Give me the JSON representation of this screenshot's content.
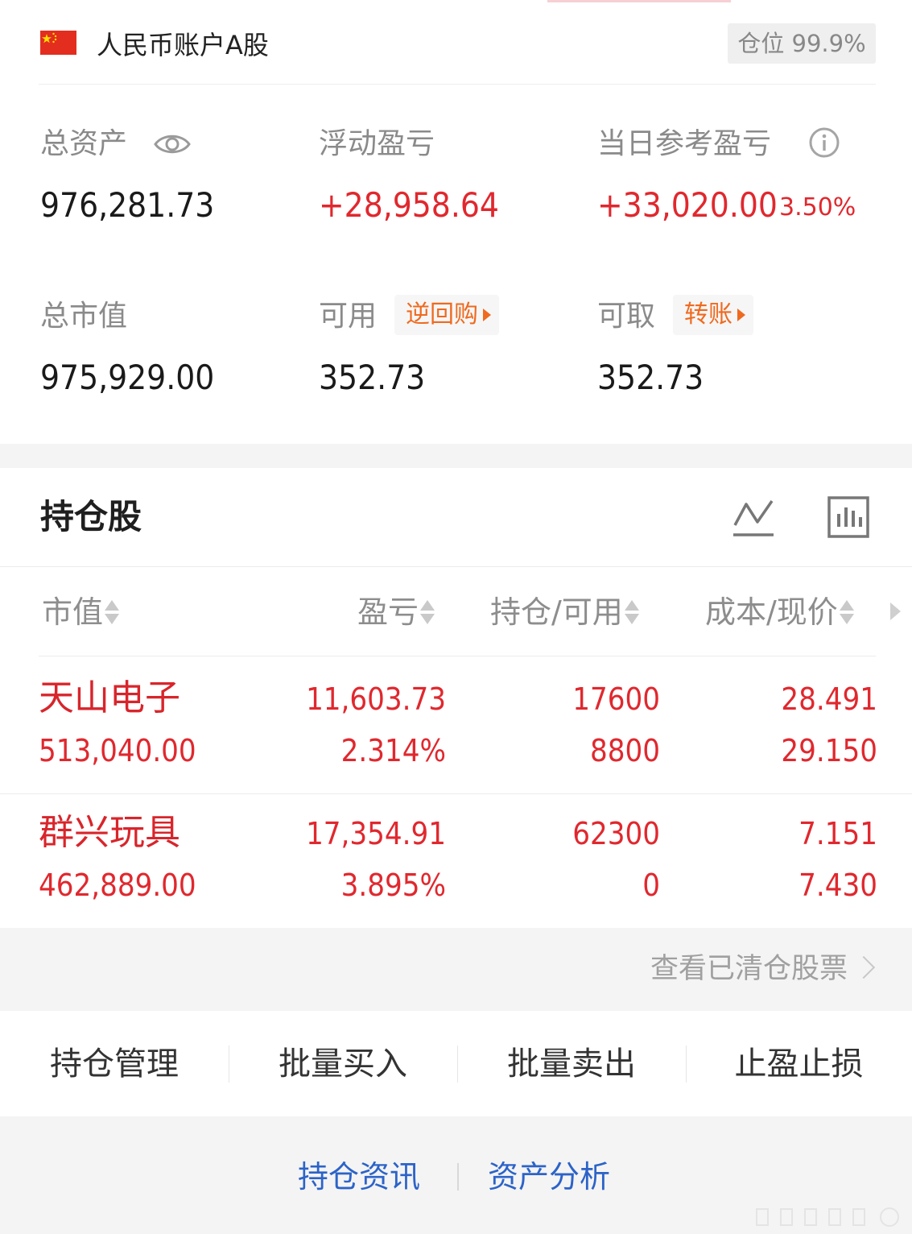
{
  "account": {
    "name": "人民币账户A股",
    "position_label": "仓位 99.9%"
  },
  "summary": {
    "total_assets_label": "总资产",
    "total_assets_value": "976,281.73",
    "floating_pl_label": "浮动盈亏",
    "floating_pl_value": "+28,958.64",
    "daily_pl_label": "当日参考盈亏",
    "daily_pl_value": "+33,020.00",
    "daily_pl_pct": "3.50%",
    "market_value_label": "总市值",
    "market_value_value": "975,929.00",
    "available_label": "可用",
    "available_tag": "逆回购",
    "available_value": "352.73",
    "withdrawable_label": "可取",
    "withdrawable_tag": "转账",
    "withdrawable_value": "352.73"
  },
  "holdings": {
    "title": "持仓股",
    "columns": [
      "市值",
      "盈亏",
      "持仓/可用",
      "成本/现价"
    ],
    "rows": [
      {
        "name": "天山电子",
        "market_value": "513,040.00",
        "pl": "11,603.73",
        "pl_pct": "2.314%",
        "position": "17600",
        "available": "8800",
        "cost": "28.491",
        "price": "29.150"
      },
      {
        "name": "群兴玩具",
        "market_value": "462,889.00",
        "pl": "17,354.91",
        "pl_pct": "3.895%",
        "position": "62300",
        "available": "0",
        "cost": "7.151",
        "price": "7.430"
      }
    ],
    "cleared_link": "查看已清仓股票"
  },
  "actions": [
    "持仓管理",
    "批量买入",
    "批量卖出",
    "止盈止损"
  ],
  "bottom_links": [
    "持仓资讯",
    "资产分析"
  ],
  "colors": {
    "up_red": "#e0282e",
    "tag_orange": "#ef6a1f",
    "link_blue": "#2c63c8"
  },
  "icons": {
    "flag": "china-flag-icon",
    "eye": "eye-icon",
    "info": "info-icon",
    "line_chart": "line-chart-icon",
    "bar_chart": "bar-chart-icon"
  }
}
